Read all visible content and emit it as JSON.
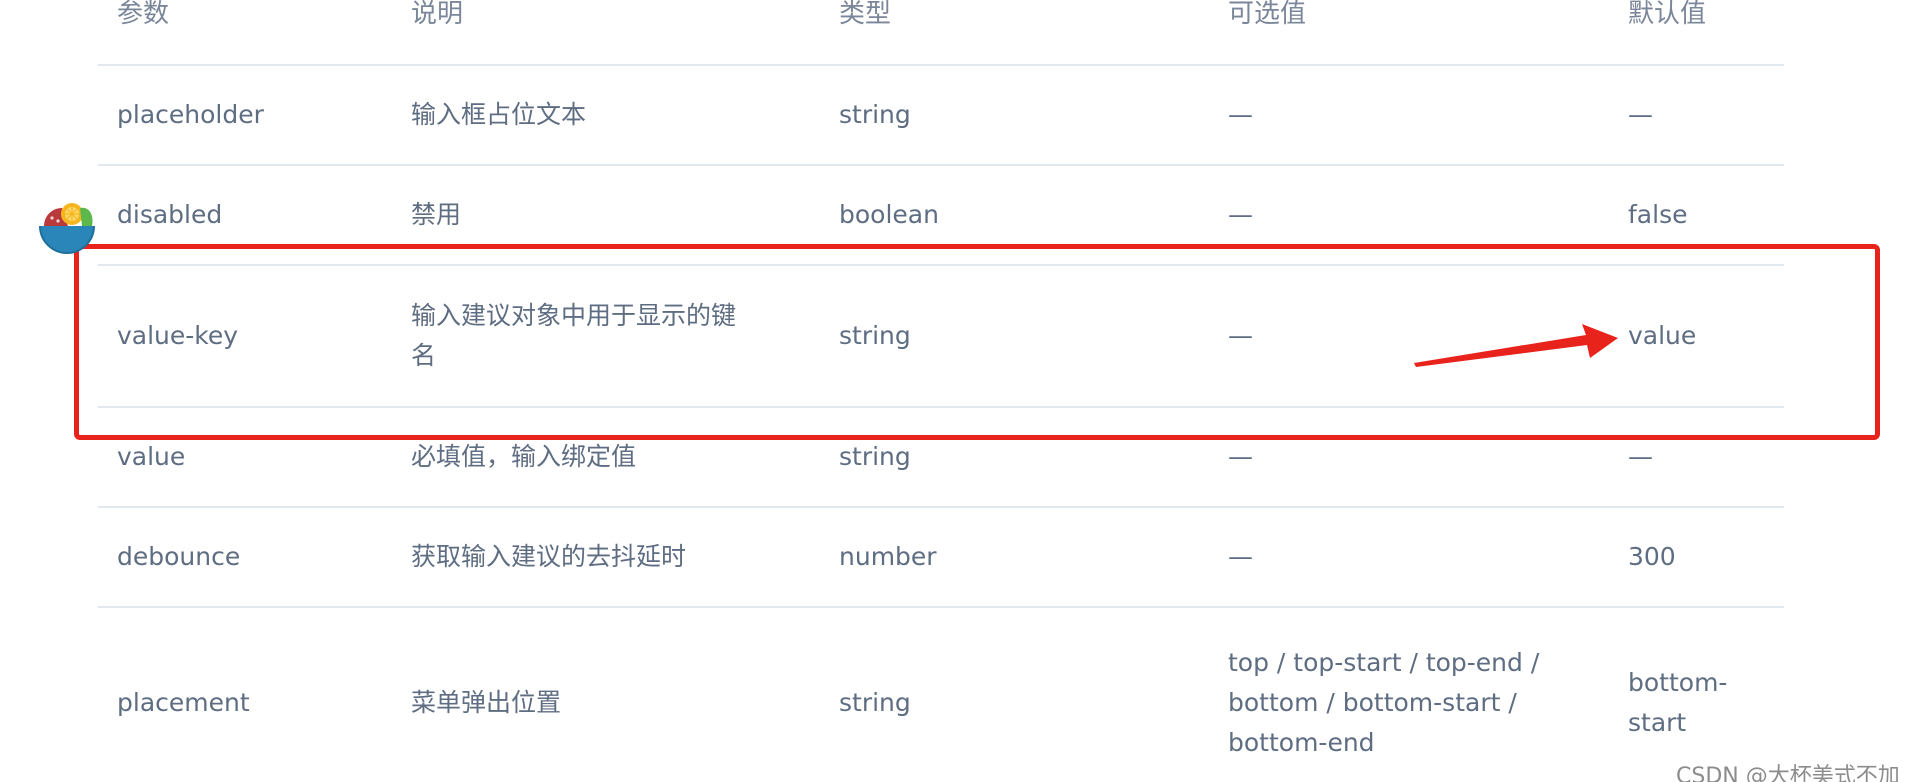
{
  "table": {
    "headers": [
      "参数",
      "说明",
      "类型",
      "可选值",
      "默认值"
    ],
    "rows": [
      {
        "param": "placeholder",
        "desc": [
          "输入框占位文本"
        ],
        "type": "string",
        "options": [
          "—"
        ],
        "default": [
          "—"
        ]
      },
      {
        "param": "disabled",
        "desc": [
          "禁用"
        ],
        "type": "boolean",
        "options": [
          "—"
        ],
        "default": [
          "false"
        ]
      },
      {
        "param": "value-key",
        "desc": [
          "输入建议对象中用于显示的键",
          "名"
        ],
        "type": "string",
        "options": [
          "—"
        ],
        "default": [
          "value"
        ]
      },
      {
        "param": "value",
        "desc": [
          "必填值，输入绑定值"
        ],
        "type": "string",
        "options": [
          "—"
        ],
        "default": [
          "—"
        ]
      },
      {
        "param": "debounce",
        "desc": [
          "获取输入建议的去抖延时"
        ],
        "type": "number",
        "options": [
          "—"
        ],
        "default": [
          "300"
        ]
      },
      {
        "param": "placement",
        "desc": [
          "菜单弹出位置"
        ],
        "type": "string",
        "options": [
          "top / top-start / top-end /",
          "bottom / bottom-start /",
          "bottom-end"
        ],
        "default": [
          "bottom-",
          "start"
        ]
      }
    ]
  },
  "annotation": {
    "box_color": "#e8231b",
    "arrow_color": "#e8231b"
  },
  "watermark": "CSDN @大杯美式不加"
}
